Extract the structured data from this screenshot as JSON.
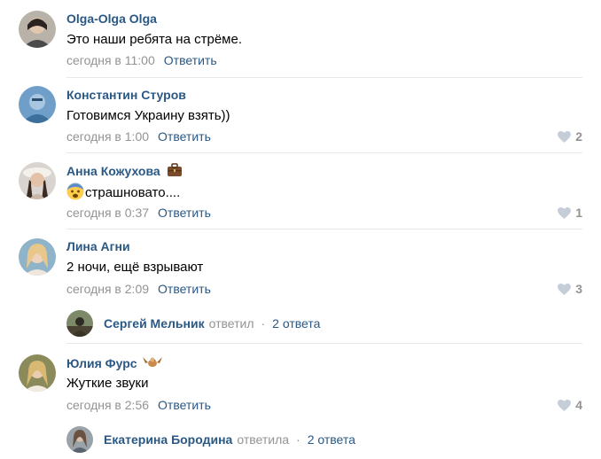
{
  "comments": [
    {
      "author": "Olga-Olga Olga",
      "text": "Это наши ребята на стрёме.",
      "date": "сегодня в 11:00",
      "reply_label": "Ответить",
      "likes": ""
    },
    {
      "author": "Константин Стуров",
      "text": "Готовимся Украину взять))",
      "date": "сегодня в 1:00",
      "reply_label": "Ответить",
      "likes": "2"
    },
    {
      "author": "Анна Кожухова",
      "author_badge_icon": "briefcase-icon",
      "text_emoji_icon": "fearful-face-emoji-icon",
      "text": "страшновато....",
      "date": "сегодня в 0:37",
      "reply_label": "Ответить",
      "likes": "1"
    },
    {
      "author": "Лина Агни",
      "text": "2 ночи, ещё взрывают",
      "date": "сегодня в 2:09",
      "reply_label": "Ответить",
      "likes": "3",
      "thread": {
        "author": "Сергей Мельник",
        "action": "ответил",
        "separator": "·",
        "count": "2 ответа"
      }
    },
    {
      "author": "Юлия Фурс",
      "author_badge_icon": "bird-icon",
      "text": "Жуткие звуки",
      "date": "сегодня в 2:56",
      "reply_label": "Ответить",
      "likes": "4",
      "thread": {
        "author": "Екатерина Бородина",
        "action": "ответила",
        "separator": "·",
        "count": "2 ответа"
      }
    }
  ],
  "colors": {
    "link": "#2a5885",
    "meta": "#939393",
    "divider": "#e7e8ec",
    "heart": "#c5cdd8"
  }
}
